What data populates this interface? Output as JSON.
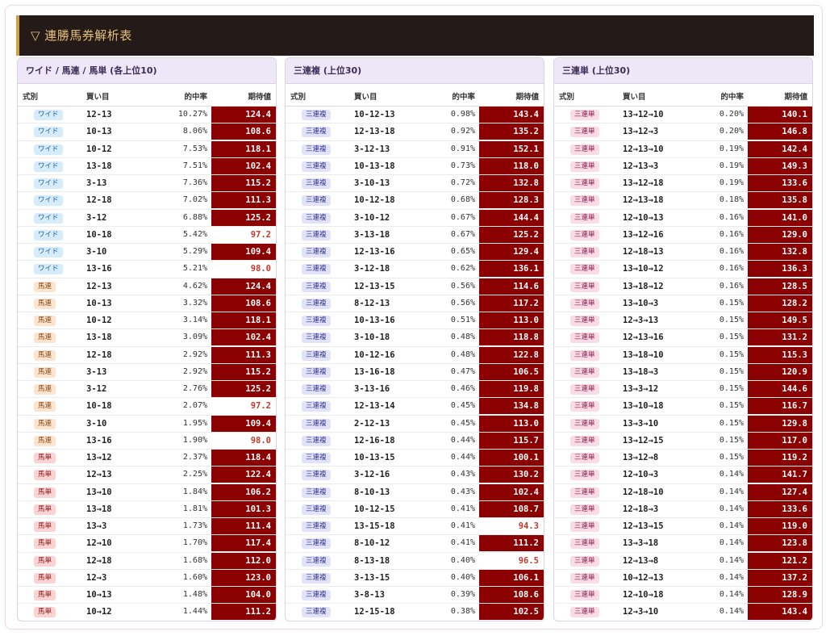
{
  "header": {
    "title": "▽ 連勝馬券解析表"
  },
  "columns": {
    "type": "式別",
    "combo": "買い目",
    "rate": "的中率",
    "ev": "期待値"
  },
  "panels": [
    {
      "title": "ワイド / 馬連 / 馬単 (各上位10)",
      "rows": [
        {
          "type": "ワイド",
          "combo": "12-13",
          "rate": "10.27%",
          "ev": "124.4"
        },
        {
          "type": "ワイド",
          "combo": "10-13",
          "rate": "8.06%",
          "ev": "108.6"
        },
        {
          "type": "ワイド",
          "combo": "10-12",
          "rate": "7.53%",
          "ev": "118.1"
        },
        {
          "type": "ワイド",
          "combo": "13-18",
          "rate": "7.51%",
          "ev": "102.4"
        },
        {
          "type": "ワイド",
          "combo": "3-13",
          "rate": "7.36%",
          "ev": "115.2"
        },
        {
          "type": "ワイド",
          "combo": "12-18",
          "rate": "7.02%",
          "ev": "111.3"
        },
        {
          "type": "ワイド",
          "combo": "3-12",
          "rate": "6.88%",
          "ev": "125.2"
        },
        {
          "type": "ワイド",
          "combo": "10-18",
          "rate": "5.42%",
          "ev": "97.2"
        },
        {
          "type": "ワイド",
          "combo": "3-10",
          "rate": "5.29%",
          "ev": "109.4"
        },
        {
          "type": "ワイド",
          "combo": "13-16",
          "rate": "5.21%",
          "ev": "98.0"
        },
        {
          "type": "馬連",
          "combo": "12-13",
          "rate": "4.62%",
          "ev": "124.4"
        },
        {
          "type": "馬連",
          "combo": "10-13",
          "rate": "3.32%",
          "ev": "108.6"
        },
        {
          "type": "馬連",
          "combo": "10-12",
          "rate": "3.14%",
          "ev": "118.1"
        },
        {
          "type": "馬連",
          "combo": "13-18",
          "rate": "3.09%",
          "ev": "102.4"
        },
        {
          "type": "馬連",
          "combo": "12-18",
          "rate": "2.92%",
          "ev": "111.3"
        },
        {
          "type": "馬連",
          "combo": "3-13",
          "rate": "2.92%",
          "ev": "115.2"
        },
        {
          "type": "馬連",
          "combo": "3-12",
          "rate": "2.76%",
          "ev": "125.2"
        },
        {
          "type": "馬連",
          "combo": "10-18",
          "rate": "2.07%",
          "ev": "97.2"
        },
        {
          "type": "馬連",
          "combo": "3-10",
          "rate": "1.95%",
          "ev": "109.4"
        },
        {
          "type": "馬連",
          "combo": "13-16",
          "rate": "1.90%",
          "ev": "98.0"
        },
        {
          "type": "馬単",
          "combo": "13→12",
          "rate": "2.37%",
          "ev": "118.4"
        },
        {
          "type": "馬単",
          "combo": "12→13",
          "rate": "2.25%",
          "ev": "122.4"
        },
        {
          "type": "馬単",
          "combo": "13→10",
          "rate": "1.84%",
          "ev": "106.2"
        },
        {
          "type": "馬単",
          "combo": "13→18",
          "rate": "1.81%",
          "ev": "101.3"
        },
        {
          "type": "馬単",
          "combo": "13→3",
          "rate": "1.73%",
          "ev": "111.4"
        },
        {
          "type": "馬単",
          "combo": "12→10",
          "rate": "1.70%",
          "ev": "117.4"
        },
        {
          "type": "馬単",
          "combo": "12→18",
          "rate": "1.68%",
          "ev": "112.0"
        },
        {
          "type": "馬単",
          "combo": "12→3",
          "rate": "1.60%",
          "ev": "123.0"
        },
        {
          "type": "馬単",
          "combo": "10→13",
          "rate": "1.48%",
          "ev": "104.0"
        },
        {
          "type": "馬単",
          "combo": "10→12",
          "rate": "1.44%",
          "ev": "111.2"
        }
      ]
    },
    {
      "title": "三連複 (上位30)",
      "rows": [
        {
          "type": "三連複",
          "combo": "10-12-13",
          "rate": "0.98%",
          "ev": "143.4"
        },
        {
          "type": "三連複",
          "combo": "12-13-18",
          "rate": "0.92%",
          "ev": "135.2"
        },
        {
          "type": "三連複",
          "combo": "3-12-13",
          "rate": "0.91%",
          "ev": "152.1"
        },
        {
          "type": "三連複",
          "combo": "10-13-18",
          "rate": "0.73%",
          "ev": "118.0"
        },
        {
          "type": "三連複",
          "combo": "3-10-13",
          "rate": "0.72%",
          "ev": "132.8"
        },
        {
          "type": "三連複",
          "combo": "10-12-18",
          "rate": "0.68%",
          "ev": "128.3"
        },
        {
          "type": "三連複",
          "combo": "3-10-12",
          "rate": "0.67%",
          "ev": "144.4"
        },
        {
          "type": "三連複",
          "combo": "3-13-18",
          "rate": "0.67%",
          "ev": "125.2"
        },
        {
          "type": "三連複",
          "combo": "12-13-16",
          "rate": "0.65%",
          "ev": "129.4"
        },
        {
          "type": "三連複",
          "combo": "3-12-18",
          "rate": "0.62%",
          "ev": "136.1"
        },
        {
          "type": "三連複",
          "combo": "12-13-15",
          "rate": "0.56%",
          "ev": "114.6"
        },
        {
          "type": "三連複",
          "combo": "8-12-13",
          "rate": "0.56%",
          "ev": "117.2"
        },
        {
          "type": "三連複",
          "combo": "10-13-16",
          "rate": "0.51%",
          "ev": "113.0"
        },
        {
          "type": "三連複",
          "combo": "3-10-18",
          "rate": "0.48%",
          "ev": "118.8"
        },
        {
          "type": "三連複",
          "combo": "10-12-16",
          "rate": "0.48%",
          "ev": "122.8"
        },
        {
          "type": "三連複",
          "combo": "13-16-18",
          "rate": "0.47%",
          "ev": "106.5"
        },
        {
          "type": "三連複",
          "combo": "3-13-16",
          "rate": "0.46%",
          "ev": "119.8"
        },
        {
          "type": "三連複",
          "combo": "12-13-14",
          "rate": "0.45%",
          "ev": "134.8"
        },
        {
          "type": "三連複",
          "combo": "2-12-13",
          "rate": "0.45%",
          "ev": "113.0"
        },
        {
          "type": "三連複",
          "combo": "12-16-18",
          "rate": "0.44%",
          "ev": "115.7"
        },
        {
          "type": "三連複",
          "combo": "10-13-15",
          "rate": "0.44%",
          "ev": "100.1"
        },
        {
          "type": "三連複",
          "combo": "3-12-16",
          "rate": "0.43%",
          "ev": "130.2"
        },
        {
          "type": "三連複",
          "combo": "8-10-13",
          "rate": "0.43%",
          "ev": "102.4"
        },
        {
          "type": "三連複",
          "combo": "10-12-15",
          "rate": "0.41%",
          "ev": "108.7"
        },
        {
          "type": "三連複",
          "combo": "13-15-18",
          "rate": "0.41%",
          "ev": "94.3"
        },
        {
          "type": "三連複",
          "combo": "8-10-12",
          "rate": "0.41%",
          "ev": "111.2"
        },
        {
          "type": "三連複",
          "combo": "8-13-18",
          "rate": "0.40%",
          "ev": "96.5"
        },
        {
          "type": "三連複",
          "combo": "3-13-15",
          "rate": "0.40%",
          "ev": "106.1"
        },
        {
          "type": "三連複",
          "combo": "3-8-13",
          "rate": "0.39%",
          "ev": "108.6"
        },
        {
          "type": "三連複",
          "combo": "12-15-18",
          "rate": "0.38%",
          "ev": "102.5"
        }
      ]
    },
    {
      "title": "三連単 (上位30)",
      "rows": [
        {
          "type": "三連単",
          "combo": "13→12→10",
          "rate": "0.20%",
          "ev": "140.1"
        },
        {
          "type": "三連単",
          "combo": "13→12→3",
          "rate": "0.20%",
          "ev": "146.8"
        },
        {
          "type": "三連単",
          "combo": "12→13→10",
          "rate": "0.19%",
          "ev": "142.4"
        },
        {
          "type": "三連単",
          "combo": "12→13→3",
          "rate": "0.19%",
          "ev": "149.3"
        },
        {
          "type": "三連単",
          "combo": "13→12→18",
          "rate": "0.19%",
          "ev": "133.6"
        },
        {
          "type": "三連単",
          "combo": "12→13→18",
          "rate": "0.18%",
          "ev": "135.8"
        },
        {
          "type": "三連単",
          "combo": "12→10→13",
          "rate": "0.16%",
          "ev": "141.0"
        },
        {
          "type": "三連単",
          "combo": "13→12→16",
          "rate": "0.16%",
          "ev": "129.0"
        },
        {
          "type": "三連単",
          "combo": "12→18→13",
          "rate": "0.16%",
          "ev": "132.8"
        },
        {
          "type": "三連単",
          "combo": "13→10→12",
          "rate": "0.16%",
          "ev": "136.3"
        },
        {
          "type": "三連単",
          "combo": "13→18→12",
          "rate": "0.16%",
          "ev": "128.5"
        },
        {
          "type": "三連単",
          "combo": "13→10→3",
          "rate": "0.15%",
          "ev": "128.2"
        },
        {
          "type": "三連単",
          "combo": "12→3→13",
          "rate": "0.15%",
          "ev": "149.5"
        },
        {
          "type": "三連単",
          "combo": "12→13→16",
          "rate": "0.15%",
          "ev": "131.2"
        },
        {
          "type": "三連単",
          "combo": "13→18→10",
          "rate": "0.15%",
          "ev": "115.3"
        },
        {
          "type": "三連単",
          "combo": "13→18→3",
          "rate": "0.15%",
          "ev": "120.9"
        },
        {
          "type": "三連単",
          "combo": "13→3→12",
          "rate": "0.15%",
          "ev": "144.6"
        },
        {
          "type": "三連単",
          "combo": "13→10→18",
          "rate": "0.15%",
          "ev": "116.7"
        },
        {
          "type": "三連単",
          "combo": "13→3→10",
          "rate": "0.15%",
          "ev": "129.8"
        },
        {
          "type": "三連単",
          "combo": "13→12→15",
          "rate": "0.15%",
          "ev": "117.0"
        },
        {
          "type": "三連単",
          "combo": "13→12→8",
          "rate": "0.15%",
          "ev": "119.2"
        },
        {
          "type": "三連単",
          "combo": "12→10→3",
          "rate": "0.14%",
          "ev": "141.7"
        },
        {
          "type": "三連単",
          "combo": "12→18→10",
          "rate": "0.14%",
          "ev": "127.4"
        },
        {
          "type": "三連単",
          "combo": "12→18→3",
          "rate": "0.14%",
          "ev": "133.6"
        },
        {
          "type": "三連単",
          "combo": "12→13→15",
          "rate": "0.14%",
          "ev": "119.0"
        },
        {
          "type": "三連単",
          "combo": "13→3→18",
          "rate": "0.14%",
          "ev": "123.8"
        },
        {
          "type": "三連単",
          "combo": "12→13→8",
          "rate": "0.14%",
          "ev": "121.2"
        },
        {
          "type": "三連単",
          "combo": "10→12→13",
          "rate": "0.14%",
          "ev": "137.2"
        },
        {
          "type": "三連単",
          "combo": "12→10→18",
          "rate": "0.14%",
          "ev": "128.9"
        },
        {
          "type": "三連単",
          "combo": "12→3→10",
          "rate": "0.14%",
          "ev": "143.4"
        }
      ]
    }
  ]
}
